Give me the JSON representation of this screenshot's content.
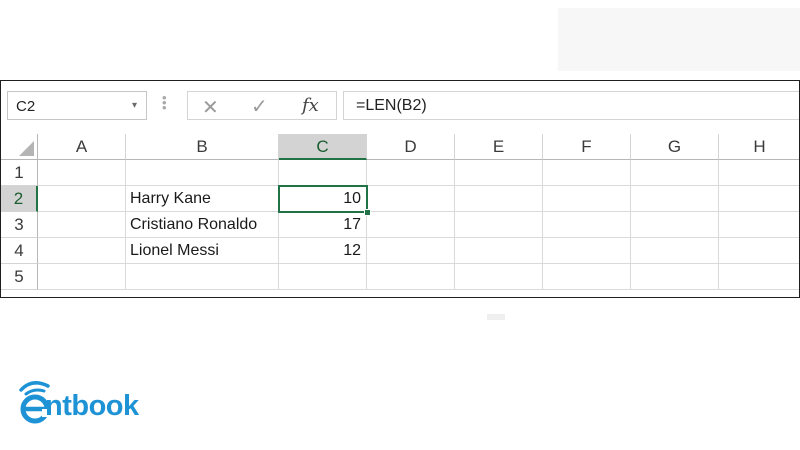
{
  "formula_bar": {
    "name_box": "C2",
    "name_box_arrow": "▾",
    "cancel_icon": "✕",
    "enter_icon": "✓",
    "fx_label": "fx",
    "formula": "=LEN(B2)"
  },
  "grid": {
    "columns": [
      "A",
      "B",
      "C",
      "D",
      "E",
      "F",
      "G",
      "H"
    ],
    "rows": [
      "1",
      "2",
      "3",
      "4",
      "5"
    ],
    "selected_column": "C",
    "selected_row": "2",
    "cells": {
      "B2": "Harry Kane",
      "C2": "10",
      "B3": "Cristiano Ronaldo",
      "C3": "17",
      "B4": "Lionel Messi",
      "C4": "12"
    }
  },
  "logo": {
    "text": "ntbook",
    "icon": "book-e-icon"
  },
  "colors": {
    "excel_green": "#217346",
    "logo_blue": "#1d93d6"
  }
}
